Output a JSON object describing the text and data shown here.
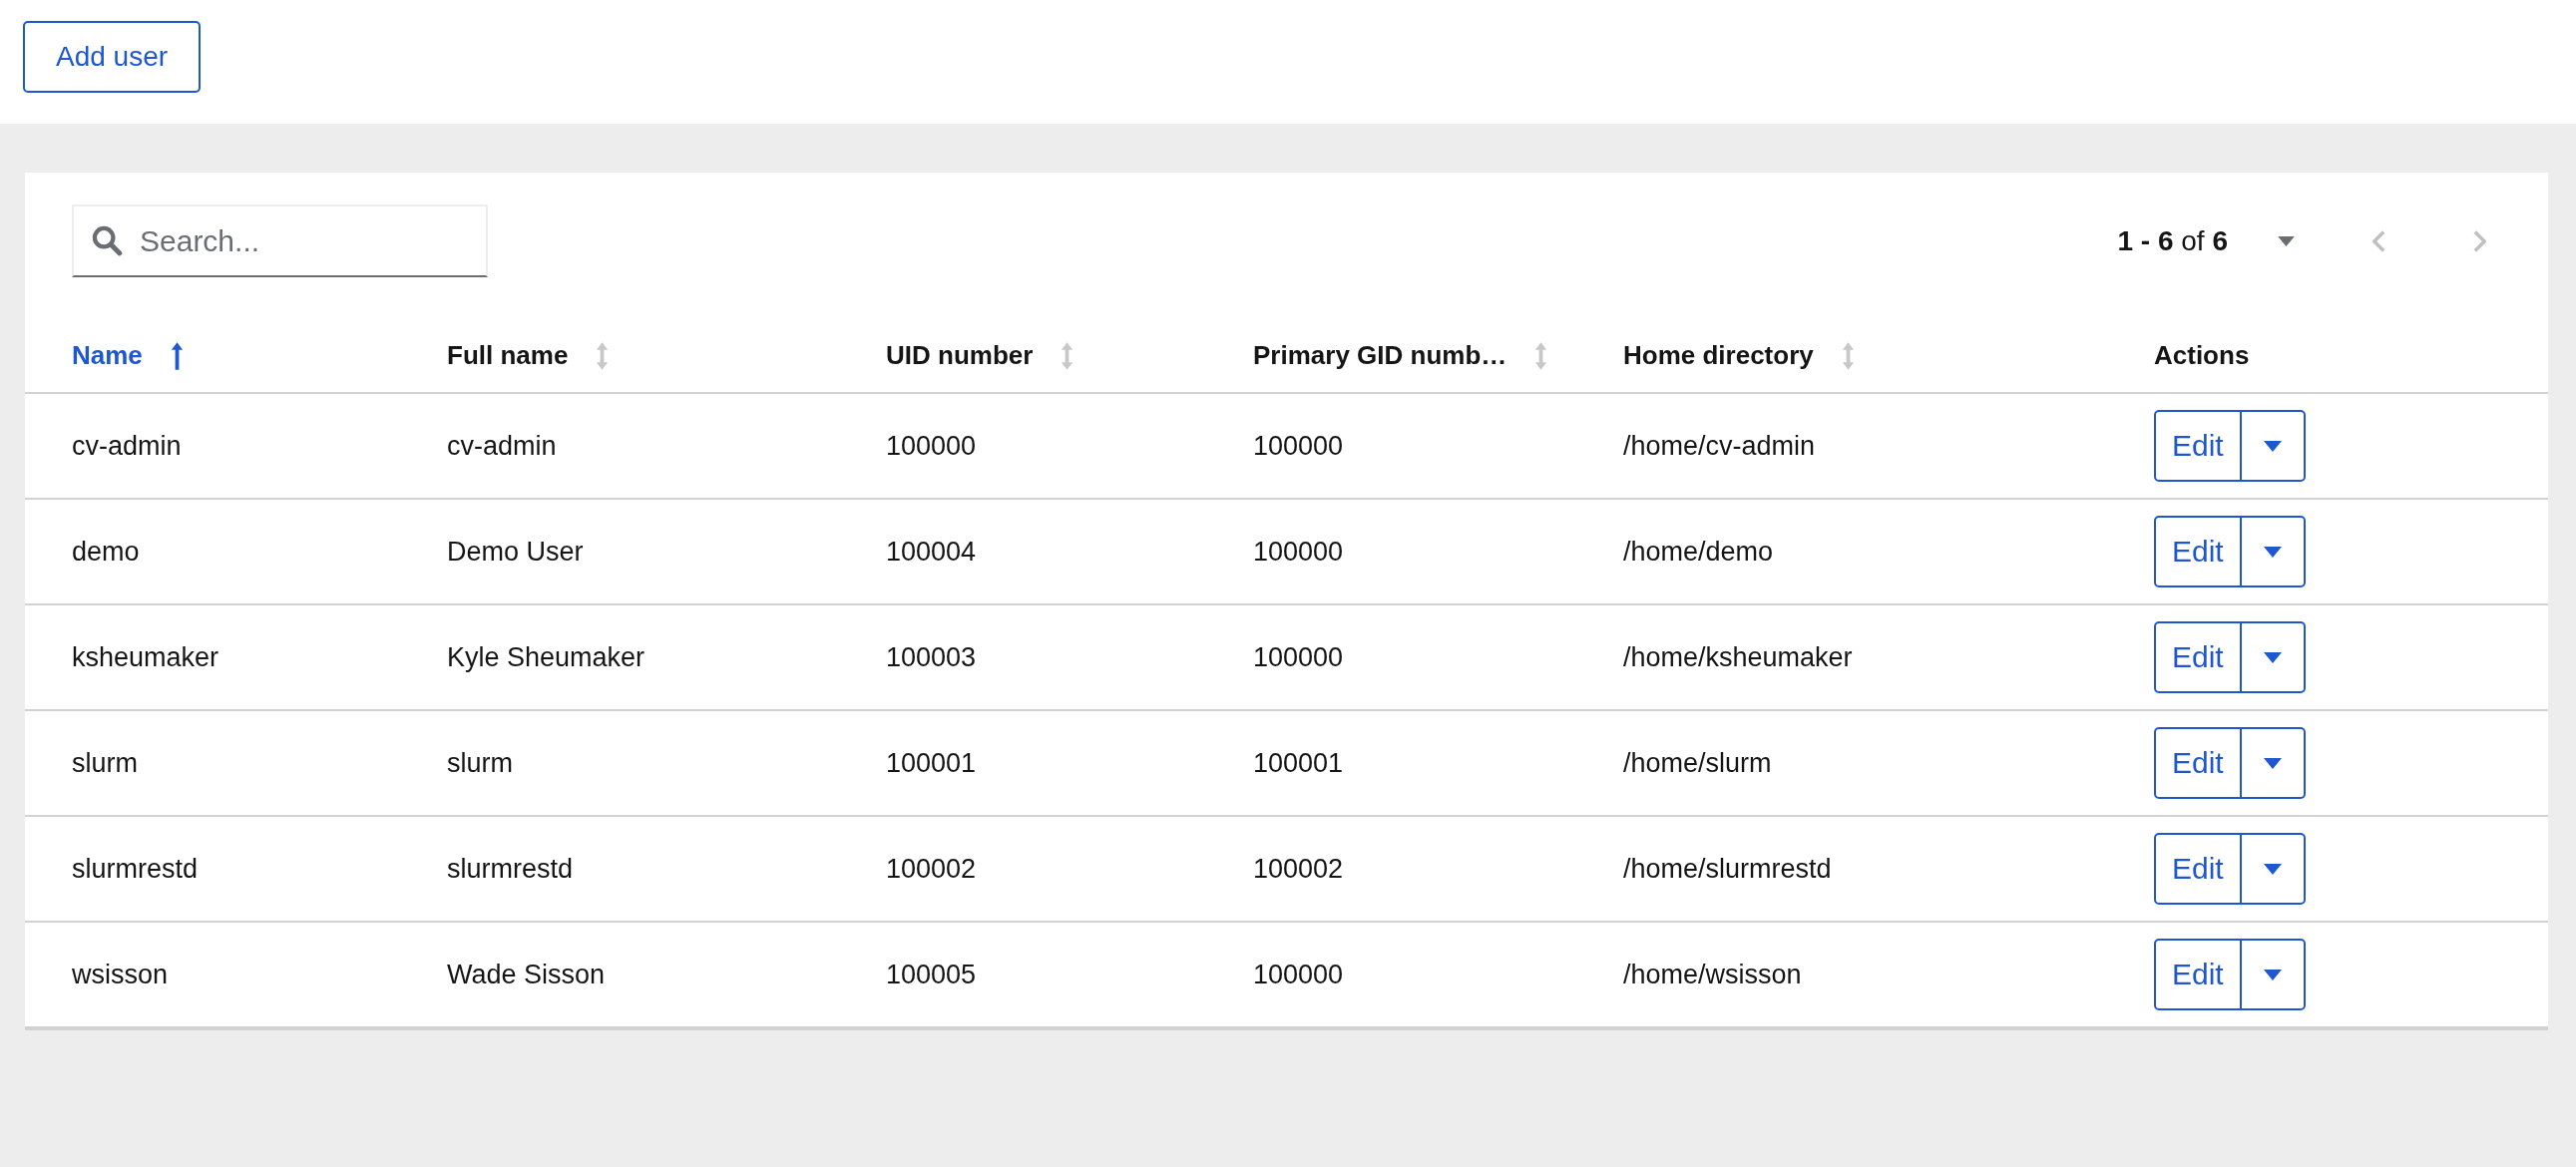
{
  "toolbar": {
    "add_button": "Add user"
  },
  "search": {
    "placeholder": "Search..."
  },
  "pagination": {
    "range": "**1 - 6** of **6**",
    "per_page_expanded": false,
    "prev_disabled": true,
    "next_disabled": true
  },
  "table": {
    "columns": [
      {
        "label": "Name",
        "sortable": true,
        "sorted": true
      },
      {
        "label": "Full name",
        "sortable": true,
        "sorted": false
      },
      {
        "label": "UID number",
        "sortable": true,
        "sorted": false
      },
      {
        "label": "Primary GID numb…",
        "sortable": true,
        "sorted": false
      },
      {
        "label": "Home directory",
        "sortable": true,
        "sorted": false
      },
      {
        "label": "Actions",
        "sortable": false,
        "sorted": false
      }
    ],
    "rows": [
      {
        "cells": [
          "cv-admin",
          "cv-admin",
          "100000",
          "100000",
          "/home/cv-admin"
        ],
        "action": "Edit"
      },
      {
        "cells": [
          "demo",
          "Demo User",
          "100004",
          "100000",
          "/home/demo"
        ],
        "action": "Edit"
      },
      {
        "cells": [
          "ksheumaker",
          "Kyle Sheumaker",
          "100003",
          "100000",
          "/home/ksheumaker"
        ],
        "action": "Edit"
      },
      {
        "cells": [
          "slurm",
          "slurm",
          "100001",
          "100001",
          "/home/slurm"
        ],
        "action": "Edit"
      },
      {
        "cells": [
          "slurmrestd",
          "slurmrestd",
          "100002",
          "100002",
          "/home/slurmrestd"
        ],
        "action": "Edit"
      },
      {
        "cells": [
          "wsisson",
          "Wade Sisson",
          "100005",
          "100000",
          "/home/wsisson"
        ],
        "action": "Edit"
      }
    ]
  }
}
